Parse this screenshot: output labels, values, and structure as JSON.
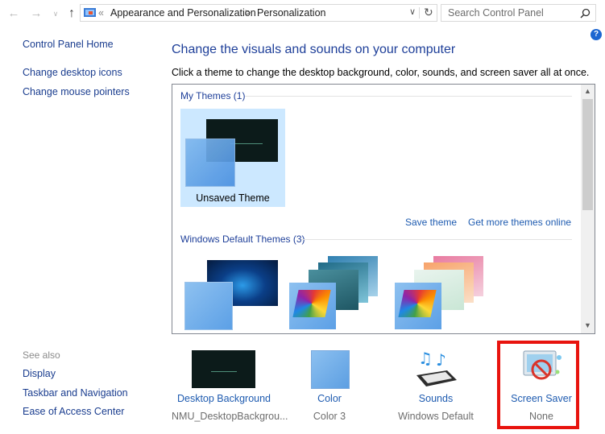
{
  "nav": {
    "back_icon": "arrow-left-icon",
    "forward_icon": "arrow-right-icon",
    "recent_icon": "chevron-down-icon",
    "up_icon": "arrow-up-icon"
  },
  "address": {
    "overflow": "«",
    "crumbs": [
      "Appearance and Personalization",
      "Personalization"
    ],
    "separator": ">",
    "dropdown_icon": "chevron-down-icon",
    "refresh_icon": "refresh-icon"
  },
  "search": {
    "placeholder": "Search Control Panel",
    "icon": "search-icon"
  },
  "help_icon": "?",
  "left": {
    "home": "Control Panel Home",
    "links": [
      "Change desktop icons",
      "Change mouse pointers"
    ],
    "see_also": "See also",
    "see_links": [
      "Display",
      "Taskbar and Navigation",
      "Ease of Access Center"
    ]
  },
  "main": {
    "title": "Change the visuals and sounds on your computer",
    "subtitle": "Click a theme to change the desktop background, color, sounds, and screen saver all at once."
  },
  "themes": {
    "my_header": "My Themes (1)",
    "unsaved": "Unsaved Theme",
    "save": "Save theme",
    "get_more": "Get more themes online",
    "default_header": "Windows Default Themes (3)"
  },
  "bottom": [
    {
      "label": "Desktop Background",
      "value": "NMU_DesktopBackgrou..."
    },
    {
      "label": "Color",
      "value": "Color 3"
    },
    {
      "label": "Sounds",
      "value": "Windows Default"
    },
    {
      "label": "Screen Saver",
      "value": "None"
    }
  ],
  "colors": {
    "link": "#1e5bb0",
    "heading": "#1e3f99",
    "highlight": "#e8130e",
    "selected": "#cce8ff"
  }
}
